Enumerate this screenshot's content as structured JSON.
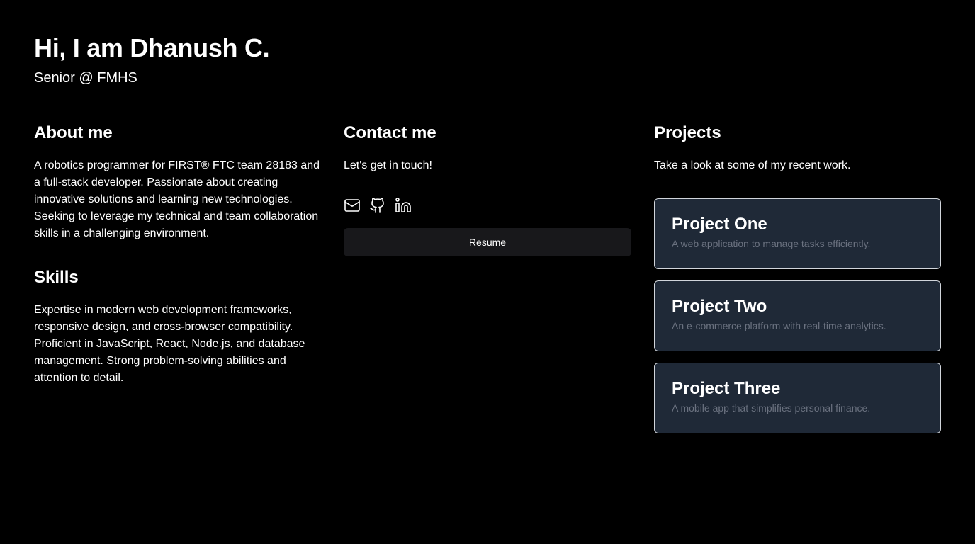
{
  "header": {
    "title": "Hi, I am Dhanush C.",
    "subtitle": "Senior @ FMHS"
  },
  "about": {
    "heading": "About me",
    "text": "A robotics programmer for FIRST® FTC team 28183 and a full-stack developer. Passionate about creating innovative solutions and learning new technologies. Seeking to leverage my technical and team collaboration skills in a challenging environment."
  },
  "skills": {
    "heading": "Skills",
    "text": "Expertise in modern web development frameworks, responsive design, and cross-browser compatibility. Proficient in JavaScript, React, Node.js, and database management. Strong problem-solving abilities and attention to detail."
  },
  "contact": {
    "heading": "Contact me",
    "text": "Let's get in touch!",
    "icons": [
      "mail-icon",
      "github-icon",
      "linkedin-icon"
    ],
    "resume_label": "Resume"
  },
  "projects": {
    "heading": "Projects",
    "text": "Take a look at some of my recent work.",
    "items": [
      {
        "title": "Project One",
        "description": "A web application to manage tasks efficiently."
      },
      {
        "title": "Project Two",
        "description": "An e-commerce platform with real-time analytics."
      },
      {
        "title": "Project Three",
        "description": "A mobile app that simplifies personal finance."
      }
    ]
  },
  "colors": {
    "background": "#000000",
    "card_background": "#1f2937",
    "card_border": "#d1d5db",
    "button_background": "#18181b",
    "muted_text": "#6b7280"
  }
}
